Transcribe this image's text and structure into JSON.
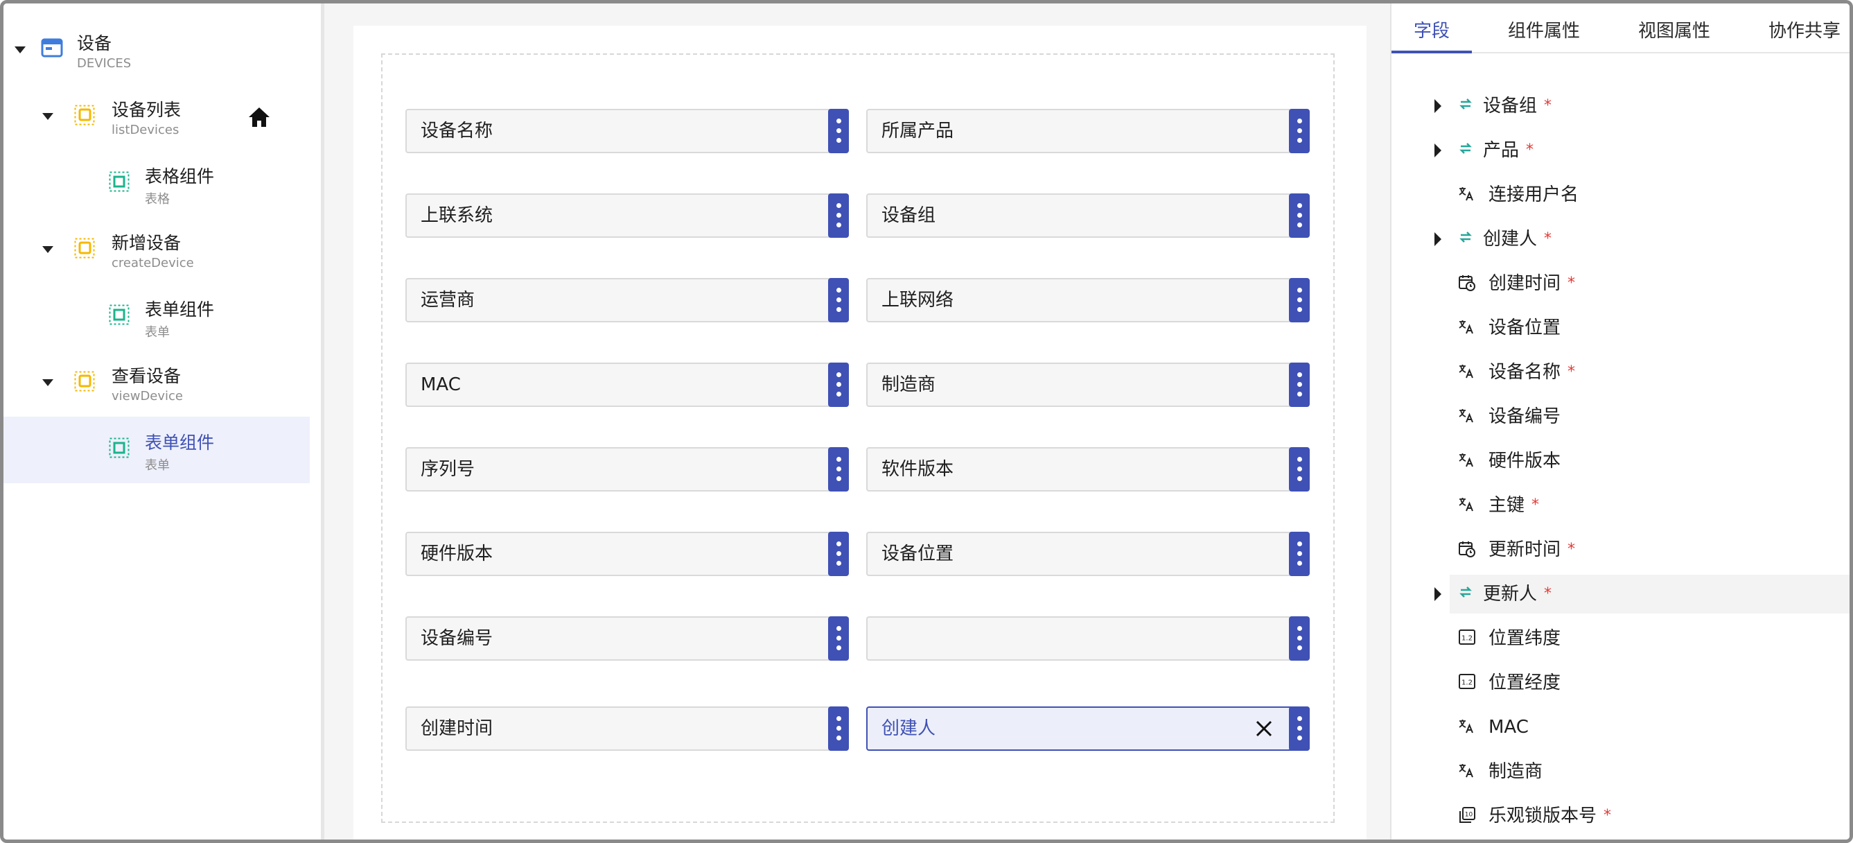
{
  "tree": {
    "nodes": [
      {
        "title": "设备",
        "subtitle": "DEVICES",
        "level": 0,
        "selected": false
      },
      {
        "title": "设备列表",
        "subtitle": "listDevices",
        "level": 1,
        "selected": false
      },
      {
        "title": "表格组件",
        "subtitle": "表格",
        "level": 2,
        "selected": false
      },
      {
        "title": "新增设备",
        "subtitle": "createDevice",
        "level": 1,
        "selected": false
      },
      {
        "title": "表单组件",
        "subtitle": "表单",
        "level": 2,
        "selected": false
      },
      {
        "title": "查看设备",
        "subtitle": "viewDevice",
        "level": 1,
        "selected": false
      },
      {
        "title": "表单组件",
        "subtitle": "表单",
        "level": 2,
        "selected": true
      }
    ],
    "home_icon": "home-icon"
  },
  "canvas": {
    "fields": [
      {
        "label": "设备名称"
      },
      {
        "label": "所属产品"
      },
      {
        "label": "上联系统"
      },
      {
        "label": "设备组"
      },
      {
        "label": "运营商"
      },
      {
        "label": "上联网络"
      },
      {
        "label": "MAC"
      },
      {
        "label": "制造商"
      },
      {
        "label": "序列号"
      },
      {
        "label": "软件版本"
      },
      {
        "label": "硬件版本"
      },
      {
        "label": "设备位置"
      },
      {
        "label": "设备编号"
      },
      {
        "label": ""
      },
      {
        "label": "创建时间"
      },
      {
        "label": "创建人",
        "active": true
      }
    ]
  },
  "panel": {
    "tabs": [
      {
        "label": "字段",
        "active": true
      },
      {
        "label": "组件属性",
        "active": false
      },
      {
        "label": "视图属性",
        "active": false
      },
      {
        "label": "协作共享",
        "active": false
      }
    ],
    "fields": [
      {
        "name": "设备组",
        "icon": "relation-icon",
        "expandable": true,
        "required": true
      },
      {
        "name": "产品",
        "icon": "relation-icon",
        "expandable": true,
        "required": true
      },
      {
        "name": "连接用户名",
        "icon": "text-icon",
        "expandable": false,
        "required": false
      },
      {
        "name": "创建人",
        "icon": "relation-icon",
        "expandable": true,
        "required": true
      },
      {
        "name": "创建时间",
        "icon": "datetime-icon",
        "expandable": false,
        "required": true
      },
      {
        "name": "设备位置",
        "icon": "text-icon",
        "expandable": false,
        "required": false
      },
      {
        "name": "设备名称",
        "icon": "text-icon",
        "expandable": false,
        "required": true
      },
      {
        "name": "设备编号",
        "icon": "text-icon",
        "expandable": false,
        "required": false
      },
      {
        "name": "硬件版本",
        "icon": "text-icon",
        "expandable": false,
        "required": false
      },
      {
        "name": "主键",
        "icon": "text-icon",
        "expandable": false,
        "required": true
      },
      {
        "name": "更新时间",
        "icon": "datetime-icon",
        "expandable": false,
        "required": true
      },
      {
        "name": "更新人",
        "icon": "relation-icon",
        "expandable": true,
        "required": true,
        "hover": true
      },
      {
        "name": "位置纬度",
        "icon": "decimal-icon",
        "expandable": false,
        "required": false
      },
      {
        "name": "位置经度",
        "icon": "decimal-icon",
        "expandable": false,
        "required": false
      },
      {
        "name": "MAC",
        "icon": "text-icon",
        "expandable": false,
        "required": false
      },
      {
        "name": "制造商",
        "icon": "text-icon",
        "expandable": false,
        "required": false
      },
      {
        "name": "乐观锁版本号",
        "icon": "version-icon",
        "expandable": false,
        "required": true
      }
    ],
    "required_mark": "*"
  },
  "colors": {
    "accent": "#3f51b5",
    "relation": "#26a69a",
    "component": "#f5b800",
    "widget": "#1bb48c",
    "required": "#e53935"
  }
}
